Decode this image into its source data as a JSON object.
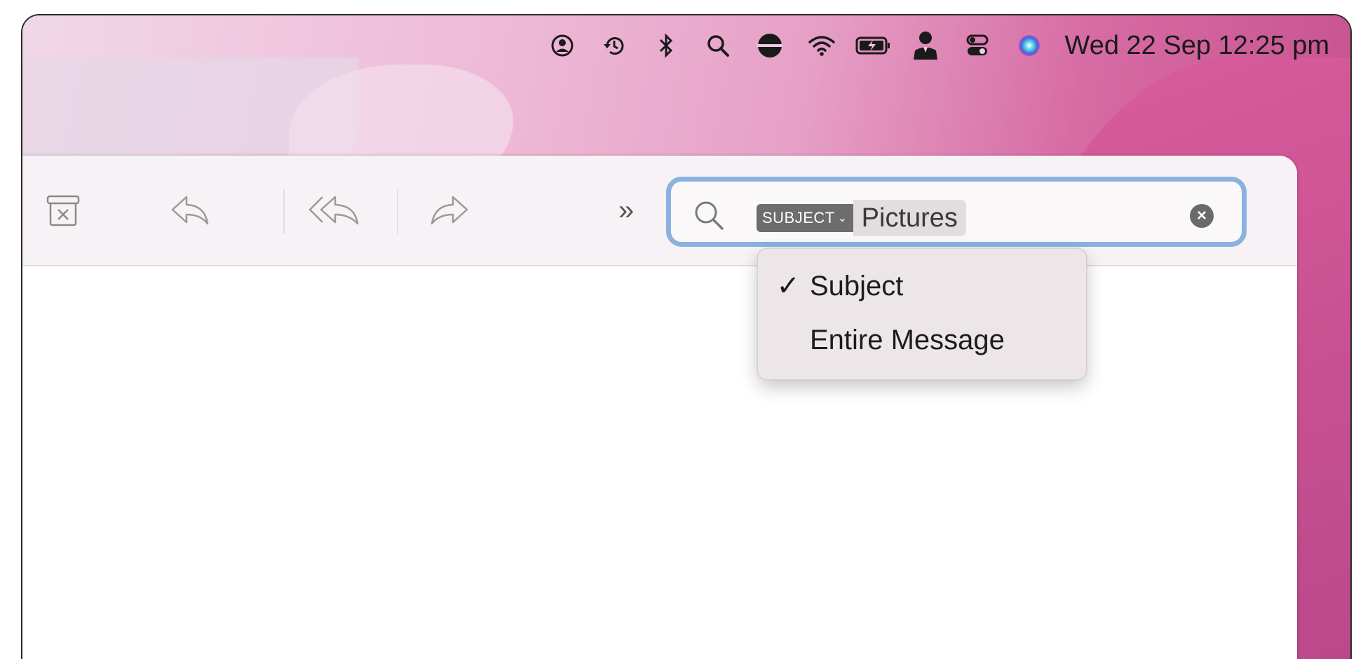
{
  "menubar": {
    "icons": [
      "user-circle-icon",
      "time-machine-icon",
      "bluetooth-icon",
      "spotlight-search-icon",
      "status-disc-icon",
      "wifi-icon",
      "battery-charging-icon",
      "user-silhouette-icon",
      "control-center-icon",
      "siri-icon"
    ],
    "datetime": "Wed 22 Sep  12:25 pm"
  },
  "toolbar": {
    "overflow_label": "»",
    "archive_icon": "archive-icon",
    "reply_icon": "reply-icon",
    "reply_all_icon": "reply-all-icon",
    "forward_icon": "forward-icon"
  },
  "search": {
    "scope_token": "SUBJECT",
    "scope_chevron": "⌄",
    "query": "Pictures",
    "clear_label": "×"
  },
  "scope_menu": {
    "items": [
      {
        "label": "Subject",
        "check": "✓"
      },
      {
        "label": "Entire Message",
        "check": ""
      }
    ]
  },
  "colors": {
    "focus_ring": "#8ab1e0",
    "wallpaper_pink": "#d66aa3",
    "token_tag": "#6d6d6d"
  }
}
